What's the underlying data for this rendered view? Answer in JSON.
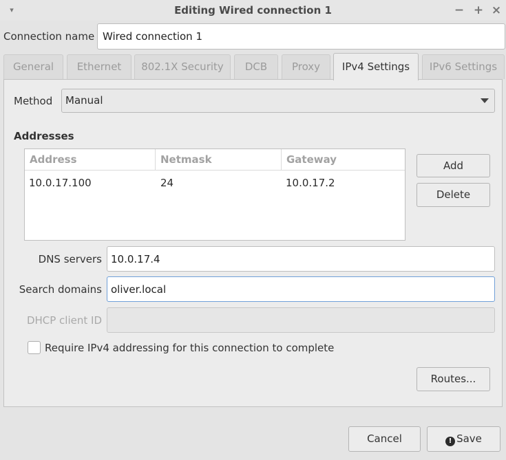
{
  "window": {
    "title": "Editing Wired connection 1",
    "menu_glyph": "▾",
    "minimize_glyph": "−",
    "maximize_glyph": "+",
    "close_glyph": "×"
  },
  "connection": {
    "label": "Connection name",
    "value": "Wired connection 1"
  },
  "tabs": [
    {
      "label": "General"
    },
    {
      "label": "Ethernet"
    },
    {
      "label": "802.1X Security"
    },
    {
      "label": "DCB"
    },
    {
      "label": "Proxy"
    },
    {
      "label": "IPv4 Settings"
    },
    {
      "label": "IPv6 Settings"
    }
  ],
  "active_tab": "IPv4 Settings",
  "ipv4": {
    "method_label": "Method",
    "method_value": "Manual",
    "addresses_heading": "Addresses",
    "table": {
      "headers": [
        "Address",
        "Netmask",
        "Gateway"
      ],
      "rows": [
        [
          "10.0.17.100",
          "24",
          "10.0.17.2"
        ]
      ]
    },
    "add_label": "Add",
    "delete_label": "Delete",
    "dns_label": "DNS servers",
    "dns_value": "10.0.17.4",
    "search_label": "Search domains",
    "search_value": "oliver.local",
    "dhcp_label": "DHCP client ID",
    "dhcp_value": "",
    "require_label": "Require IPv4 addressing for this connection to complete",
    "require_checked": false,
    "routes_label": "Routes..."
  },
  "footer": {
    "cancel_label": "Cancel",
    "save_label": "Save",
    "save_icon_glyph": "!"
  }
}
